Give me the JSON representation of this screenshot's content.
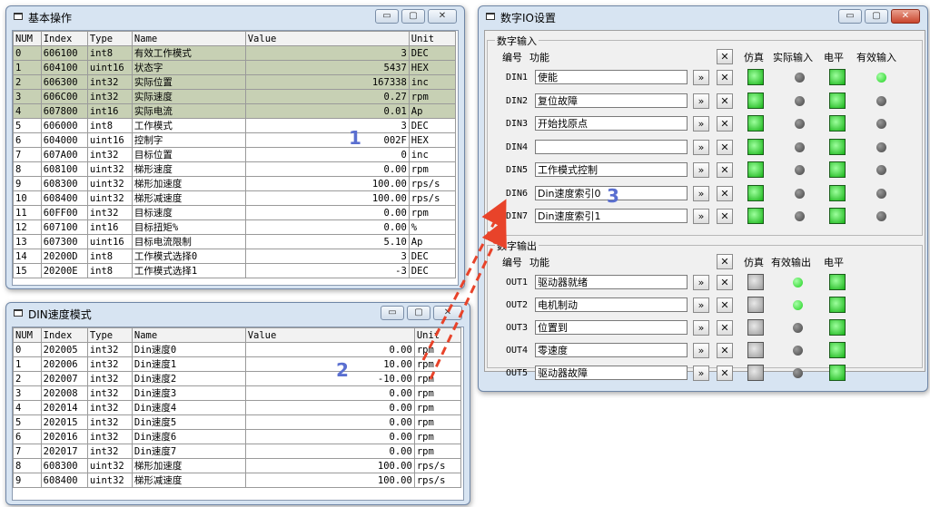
{
  "basic_window": {
    "title": "基本操作",
    "columns": [
      "NUM",
      "Index",
      "Type",
      "Name",
      "Value",
      "Unit"
    ],
    "rows": [
      {
        "num": "0",
        "index": "606100",
        "type": "int8",
        "name": "有效工作模式",
        "value": "3",
        "unit": "DEC",
        "highlight": true
      },
      {
        "num": "1",
        "index": "604100",
        "type": "uint16",
        "name": "状态字",
        "value": "5437",
        "unit": "HEX",
        "highlight": true
      },
      {
        "num": "2",
        "index": "606300",
        "type": "int32",
        "name": "实际位置",
        "value": "167338",
        "unit": "inc",
        "highlight": true
      },
      {
        "num": "3",
        "index": "606C00",
        "type": "int32",
        "name": "实际速度",
        "value": "0.27",
        "unit": "rpm",
        "highlight": true
      },
      {
        "num": "4",
        "index": "607800",
        "type": "int16",
        "name": "实际电流",
        "value": "0.01",
        "unit": "Ap",
        "highlight": true
      },
      {
        "num": "5",
        "index": "606000",
        "type": "int8",
        "name": "工作模式",
        "value": "3",
        "unit": "DEC",
        "highlight": false
      },
      {
        "num": "6",
        "index": "604000",
        "type": "uint16",
        "name": "控制字",
        "value": "002F",
        "unit": "HEX",
        "highlight": false
      },
      {
        "num": "7",
        "index": "607A00",
        "type": "int32",
        "name": "目标位置",
        "value": "0",
        "unit": "inc",
        "highlight": false
      },
      {
        "num": "8",
        "index": "608100",
        "type": "uint32",
        "name": "梯形速度",
        "value": "0.00",
        "unit": "rpm",
        "highlight": false
      },
      {
        "num": "9",
        "index": "608300",
        "type": "uint32",
        "name": "梯形加速度",
        "value": "100.00",
        "unit": "rps/s",
        "highlight": false
      },
      {
        "num": "10",
        "index": "608400",
        "type": "uint32",
        "name": "梯形减速度",
        "value": "100.00",
        "unit": "rps/s",
        "highlight": false
      },
      {
        "num": "11",
        "index": "60FF00",
        "type": "int32",
        "name": "目标速度",
        "value": "0.00",
        "unit": "rpm",
        "highlight": false
      },
      {
        "num": "12",
        "index": "607100",
        "type": "int16",
        "name": "目标扭矩%",
        "value": "0.00",
        "unit": "%",
        "highlight": false
      },
      {
        "num": "13",
        "index": "607300",
        "type": "uint16",
        "name": "目标电流限制",
        "value": "5.10",
        "unit": "Ap",
        "highlight": false
      },
      {
        "num": "14",
        "index": "20200D",
        "type": "int8",
        "name": "工作模式选择0",
        "value": "3",
        "unit": "DEC",
        "highlight": false
      },
      {
        "num": "15",
        "index": "20200E",
        "type": "int8",
        "name": "工作模式选择1",
        "value": "-3",
        "unit": "DEC",
        "highlight": false
      }
    ]
  },
  "din_window": {
    "title": "DIN速度模式",
    "columns": [
      "NUM",
      "Index",
      "Type",
      "Name",
      "Value",
      "Unit"
    ],
    "rows": [
      {
        "num": "0",
        "index": "202005",
        "type": "int32",
        "name": "Din速度0",
        "value": "0.00",
        "unit": "rpm"
      },
      {
        "num": "1",
        "index": "202006",
        "type": "int32",
        "name": "Din速度1",
        "value": "10.00",
        "unit": "rpm"
      },
      {
        "num": "2",
        "index": "202007",
        "type": "int32",
        "name": "Din速度2",
        "value": "-10.00",
        "unit": "rpm"
      },
      {
        "num": "3",
        "index": "202008",
        "type": "int32",
        "name": "Din速度3",
        "value": "0.00",
        "unit": "rpm"
      },
      {
        "num": "4",
        "index": "202014",
        "type": "int32",
        "name": "Din速度4",
        "value": "0.00",
        "unit": "rpm"
      },
      {
        "num": "5",
        "index": "202015",
        "type": "int32",
        "name": "Din速度5",
        "value": "0.00",
        "unit": "rpm"
      },
      {
        "num": "6",
        "index": "202016",
        "type": "int32",
        "name": "Din速度6",
        "value": "0.00",
        "unit": "rpm"
      },
      {
        "num": "7",
        "index": "202017",
        "type": "int32",
        "name": "Din速度7",
        "value": "0.00",
        "unit": "rpm"
      },
      {
        "num": "8",
        "index": "608300",
        "type": "uint32",
        "name": "梯形加速度",
        "value": "100.00",
        "unit": "rps/s"
      },
      {
        "num": "9",
        "index": "608400",
        "type": "uint32",
        "name": "梯形减速度",
        "value": "100.00",
        "unit": "rps/s"
      }
    ]
  },
  "io_window": {
    "title": "数字IO设置",
    "input_group": {
      "label": "数字输入",
      "headers": {
        "id": "编号",
        "func": "功能",
        "sim": "仿真",
        "actual": "实际输入",
        "level": "电平",
        "effective": "有效输入"
      },
      "rows": [
        {
          "id": "DIN1",
          "func": "使能",
          "sim": "green",
          "actual": "dark",
          "level": "green",
          "effective": "green"
        },
        {
          "id": "DIN2",
          "func": "复位故障",
          "sim": "green",
          "actual": "dark",
          "level": "green",
          "effective": "dark"
        },
        {
          "id": "DIN3",
          "func": "开始找原点",
          "sim": "green",
          "actual": "dark",
          "level": "green",
          "effective": "dark"
        },
        {
          "id": "DIN4",
          "func": "",
          "sim": "green",
          "actual": "dark",
          "level": "green",
          "effective": "dark"
        },
        {
          "id": "DIN5",
          "func": "工作模式控制",
          "sim": "green",
          "actual": "dark",
          "level": "green",
          "effective": "dark"
        },
        {
          "id": "DIN6",
          "func": "Din速度索引0",
          "sim": "green",
          "actual": "dark",
          "level": "green",
          "effective": "dark"
        },
        {
          "id": "DIN7",
          "func": "Din速度索引1",
          "sim": "green",
          "actual": "dark",
          "level": "green",
          "effective": "dark"
        }
      ]
    },
    "output_group": {
      "label": "数字输出",
      "headers": {
        "id": "编号",
        "func": "功能",
        "sim": "仿真",
        "effective": "有效输出",
        "level": "电平"
      },
      "rows": [
        {
          "id": "OUT1",
          "func": "驱动器就绪",
          "sim": "grey",
          "effective": "green",
          "level": "green"
        },
        {
          "id": "OUT2",
          "func": "电机制动",
          "sim": "grey",
          "effective": "green",
          "level": "green"
        },
        {
          "id": "OUT3",
          "func": "位置到",
          "sim": "grey",
          "effective": "dark",
          "level": "green"
        },
        {
          "id": "OUT4",
          "func": "零速度",
          "sim": "grey",
          "effective": "dark",
          "level": "green"
        },
        {
          "id": "OUT5",
          "func": "驱动器故障",
          "sim": "grey",
          "effective": "dark",
          "level": "green"
        }
      ]
    }
  },
  "callouts": {
    "one": "1",
    "two": "2",
    "three": "3"
  },
  "glyphs": {
    "minimize": "▭",
    "maximize": "▢",
    "close": "✕",
    "arrow": "»",
    "x": "✕"
  },
  "colors": {
    "highlight_row": "#c7d0b4",
    "led_green": "#1fd01f",
    "arrow_red": "#e8432a",
    "callout": "#5a6fd0"
  }
}
